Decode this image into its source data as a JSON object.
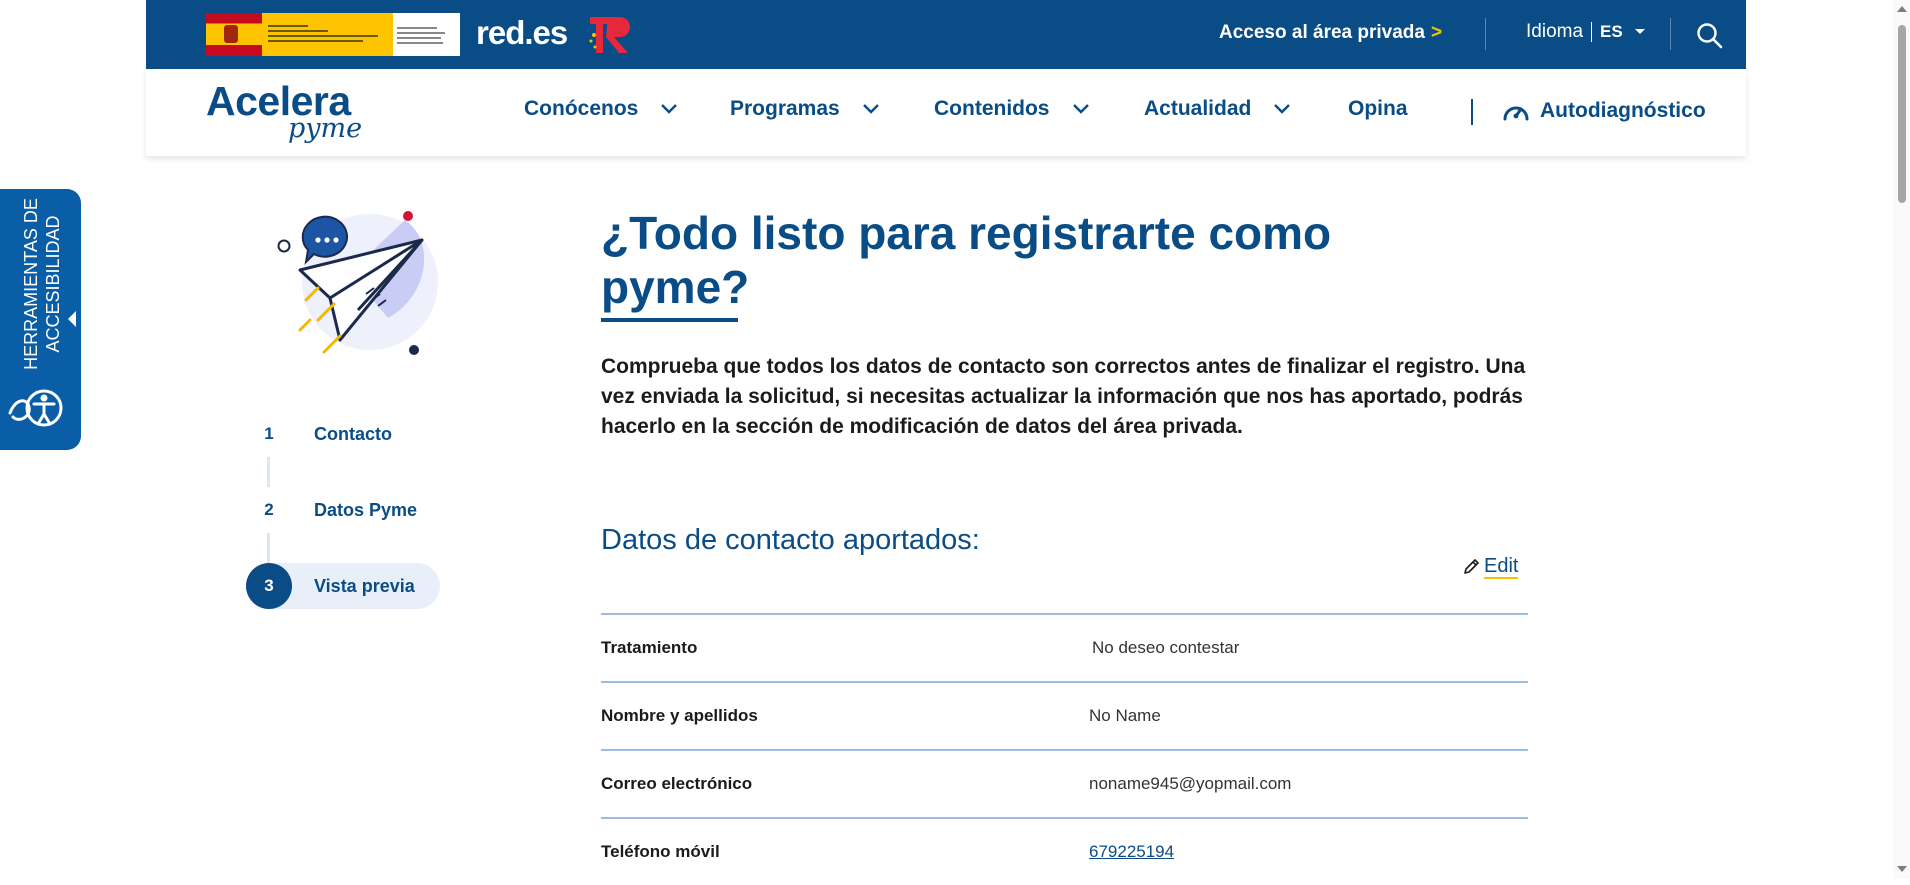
{
  "topbar": {
    "redes_label": "red.es",
    "private_area": "Acceso al área privada",
    "private_arrow": ">",
    "language_label": "Idioma",
    "language_value": "ES"
  },
  "brand": {
    "top": "Acelera",
    "bottom": "pyme"
  },
  "nav": {
    "items": [
      {
        "label": "Conócenos"
      },
      {
        "label": "Programas"
      },
      {
        "label": "Contenidos"
      },
      {
        "label": "Actualidad"
      },
      {
        "label": "Opina"
      }
    ],
    "autodiagnostico": "Autodiagnóstico"
  },
  "accessibility": {
    "label": "HERRAMIENTAS DE ACCESIBILIDAD"
  },
  "steps": [
    {
      "num": "1",
      "label": "Contacto"
    },
    {
      "num": "2",
      "label": "Datos Pyme"
    },
    {
      "num": "3",
      "label": "Vista previa"
    }
  ],
  "main": {
    "title": "¿Todo listo para registrarte como pyme?",
    "intro": "Comprueba que todos los datos de contacto son correctos antes de finalizar el registro. Una vez enviada la solicitud, si necesitas actualizar la información que nos has aportado, podrás hacerlo en la sección de modificación de datos del área privada.",
    "section_title": "Datos de contacto aportados:",
    "edit_label": "Edit",
    "rows": [
      {
        "label": "Tratamiento",
        "value": "No deseo contestar"
      },
      {
        "label": "Nombre y apellidos",
        "value": "No Name"
      },
      {
        "label": "Correo electrónico",
        "value": "noname945@yopmail.com"
      },
      {
        "label": "Teléfono móvil",
        "value": "679225194"
      }
    ]
  },
  "colors": {
    "primary": "#0a4c86",
    "accent": "#f5c400",
    "accessibility_tab": "#0a5ea8"
  }
}
